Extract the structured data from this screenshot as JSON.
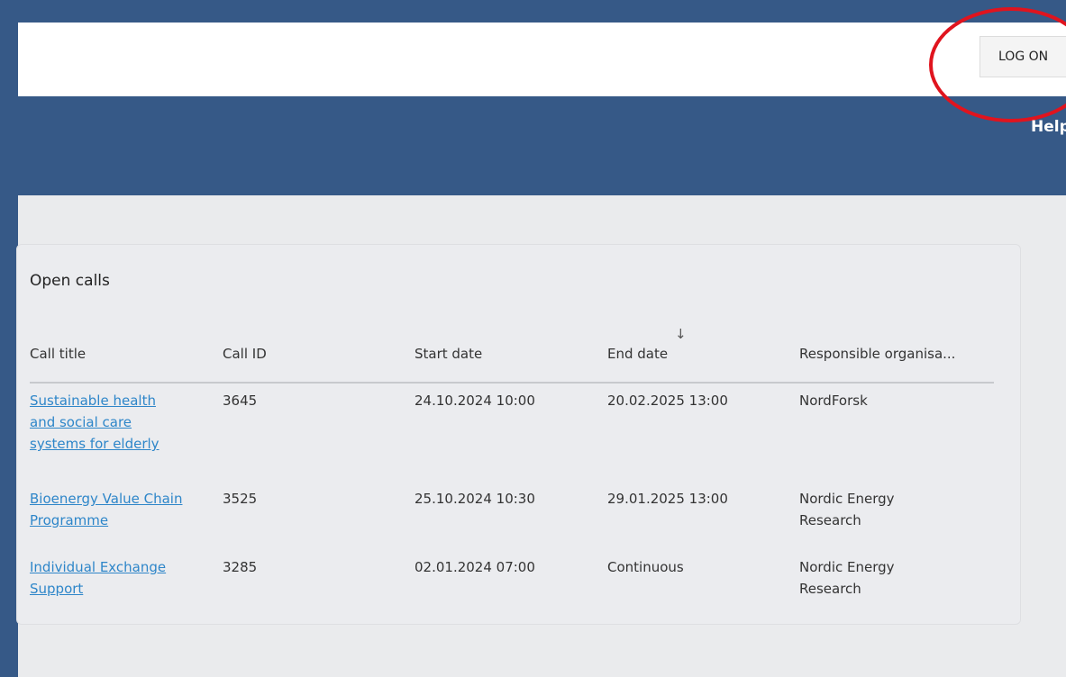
{
  "header": {
    "logon_label": "LOG ON",
    "help_label": "Help"
  },
  "calls": {
    "title": "Open calls",
    "columns": [
      "Call title",
      "Call ID",
      "Start date",
      "End date",
      "Responsible organisa..."
    ],
    "sort_icon": "arrow-down-icon",
    "rows": [
      {
        "title_lines": [
          "Sustainable health",
          "and social care",
          "systems for elderly"
        ],
        "call_id": "3645",
        "start_date": "24.10.2024 10:00",
        "end_date": "20.02.2025 13:00",
        "organisation_lines": [
          "NordForsk"
        ]
      },
      {
        "title_lines": [
          "Bioenergy Value Chain",
          "Programme"
        ],
        "call_id": "3525",
        "start_date": "25.10.2024 10:30",
        "end_date": "29.01.2025 13:00",
        "organisation_lines": [
          "Nordic Energy",
          "Research"
        ]
      },
      {
        "title_lines": [
          "Individual Exchange",
          "Support"
        ],
        "call_id": "3285",
        "start_date": "02.01.2024 07:00",
        "end_date": "Continuous",
        "organisation_lines": [
          "Nordic Energy",
          "Research"
        ]
      }
    ]
  },
  "colors": {
    "header_bg": "#365987",
    "link": "#2e86c9",
    "highlight": "#e0141e"
  }
}
